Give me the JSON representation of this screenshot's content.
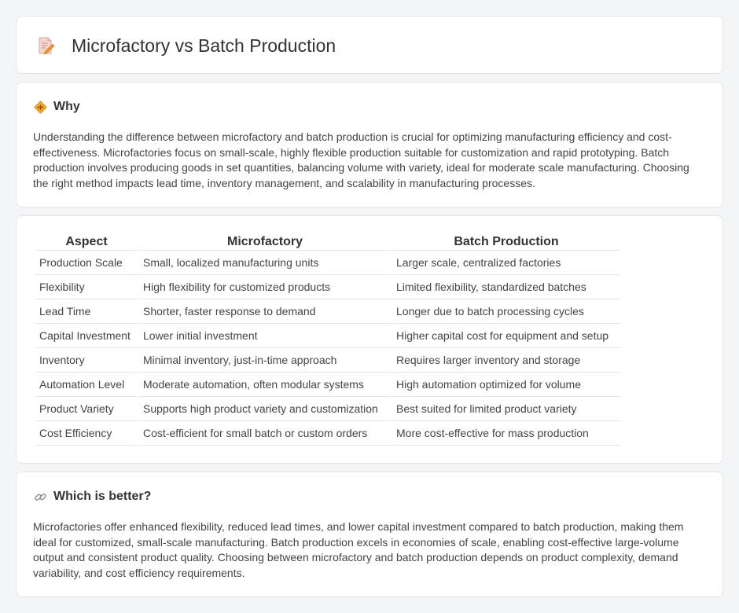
{
  "header": {
    "title": "Microfactory vs Batch Production",
    "icon": "document-pencil-icon"
  },
  "why": {
    "icon": "diamond-warning-icon",
    "title": "Why",
    "body": "Understanding the difference between microfactory and batch production is crucial for optimizing manufacturing efficiency and cost-effectiveness. Microfactories focus on small-scale, highly flexible production suitable for customization and rapid prototyping. Batch production involves producing goods in set quantities, balancing volume with variety, ideal for moderate scale manufacturing. Choosing the right method impacts lead time, inventory management, and scalability in manufacturing processes."
  },
  "comparison": {
    "headers": [
      "Aspect",
      "Microfactory",
      "Batch Production"
    ],
    "rows": [
      [
        "Production Scale",
        "Small, localized manufacturing units",
        "Larger scale, centralized factories"
      ],
      [
        "Flexibility",
        "High flexibility for customized products",
        "Limited flexibility, standardized batches"
      ],
      [
        "Lead Time",
        "Shorter, faster response to demand",
        "Longer due to batch processing cycles"
      ],
      [
        "Capital Investment",
        "Lower initial investment",
        "Higher capital cost for equipment and setup"
      ],
      [
        "Inventory",
        "Minimal inventory, just-in-time approach",
        "Requires larger inventory and storage"
      ],
      [
        "Automation Level",
        "Moderate automation, often modular systems",
        "High automation optimized for volume"
      ],
      [
        "Product Variety",
        "Supports high product variety and customization",
        "Best suited for limited product variety"
      ],
      [
        "Cost Efficiency",
        "Cost-efficient for small batch or custom orders",
        "More cost-effective for mass production"
      ]
    ]
  },
  "better": {
    "icon": "link-icon",
    "title": "Which is better?",
    "body": "Microfactories offer enhanced flexibility, reduced lead times, and lower capital investment compared to batch production, making them ideal for customized, small-scale manufacturing. Batch production excels in economies of scale, enabling cost-effective large-volume output and consistent product quality. Choosing between microfactory and batch production depends on product complexity, demand variability, and cost efficiency requirements."
  },
  "colors": {
    "page_bg": "#f4f5f7",
    "card_bg": "#ffffff",
    "text": "#333333",
    "accent_orange": "#f0932b"
  }
}
